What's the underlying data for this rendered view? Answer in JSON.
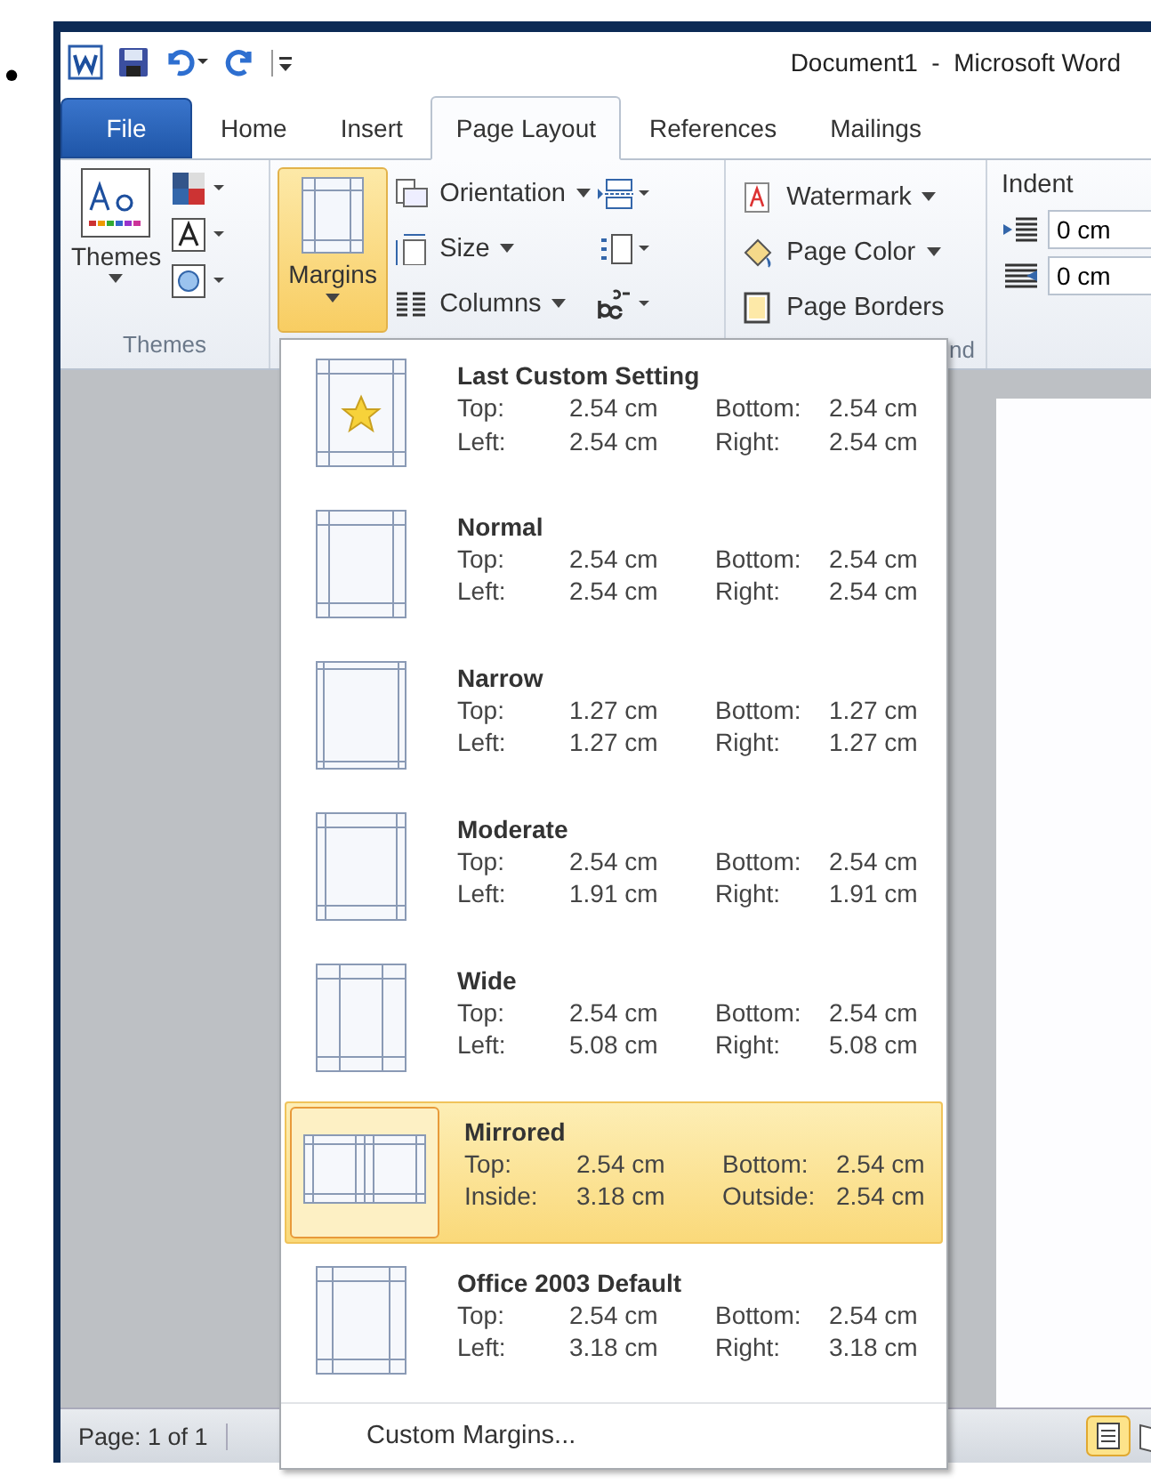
{
  "bullet": "•",
  "window": {
    "title": "Document1  -  Microsoft Word"
  },
  "tabs": [
    {
      "label": "File",
      "kind": "file",
      "selected": false
    },
    {
      "label": "Home",
      "kind": "tab",
      "selected": false
    },
    {
      "label": "Insert",
      "kind": "tab",
      "selected": false
    },
    {
      "label": "Page Layout",
      "kind": "tab",
      "selected": true
    },
    {
      "label": "References",
      "kind": "tab",
      "selected": false
    },
    {
      "label": "Mailings",
      "kind": "tab",
      "selected": false
    }
  ],
  "ribbon": {
    "themes_button": "Themes",
    "themes_group": "Themes",
    "margins_button": "Margins",
    "setup_items": [
      {
        "label": "Orientation",
        "kind": "orientation"
      },
      {
        "label": "Size",
        "kind": "size"
      },
      {
        "label": "Columns",
        "kind": "columns"
      }
    ],
    "background_items": [
      {
        "label": "Watermark",
        "kind": "watermark",
        "dropdown": true
      },
      {
        "label": "Page Color",
        "kind": "pagecolor",
        "dropdown": true
      },
      {
        "label": "Page Borders",
        "kind": "borders",
        "dropdown": false
      }
    ],
    "background_group": "nd",
    "indent_label": "Indent",
    "indent_fields": [
      {
        "value": "0 cm",
        "kind": "left"
      },
      {
        "value": "0 cm",
        "kind": "right"
      }
    ]
  },
  "margins_menu": {
    "items": [
      {
        "name": "Last Custom Setting",
        "kind": "star",
        "selected": false,
        "rows": [
          [
            "Top:",
            "2.54 cm",
            "Bottom:",
            "2.54 cm"
          ],
          [
            "Left:",
            "2.54 cm",
            "Right:",
            "2.54 cm"
          ]
        ]
      },
      {
        "name": "Normal",
        "kind": "normal",
        "selected": false,
        "rows": [
          [
            "Top:",
            "2.54 cm",
            "Bottom:",
            "2.54 cm"
          ],
          [
            "Left:",
            "2.54 cm",
            "Right:",
            "2.54 cm"
          ]
        ]
      },
      {
        "name": "Narrow",
        "kind": "narrow",
        "selected": false,
        "rows": [
          [
            "Top:",
            "1.27 cm",
            "Bottom:",
            "1.27 cm"
          ],
          [
            "Left:",
            "1.27 cm",
            "Right:",
            "1.27 cm"
          ]
        ]
      },
      {
        "name": "Moderate",
        "kind": "moderate",
        "selected": false,
        "rows": [
          [
            "Top:",
            "2.54 cm",
            "Bottom:",
            "2.54 cm"
          ],
          [
            "Left:",
            "1.91 cm",
            "Right:",
            "1.91 cm"
          ]
        ]
      },
      {
        "name": "Wide",
        "kind": "wide",
        "selected": false,
        "rows": [
          [
            "Top:",
            "2.54 cm",
            "Bottom:",
            "2.54 cm"
          ],
          [
            "Left:",
            "5.08 cm",
            "Right:",
            "5.08 cm"
          ]
        ]
      },
      {
        "name": "Mirrored",
        "kind": "mirrored",
        "selected": true,
        "rows": [
          [
            "Top:",
            "2.54 cm",
            "Bottom:",
            "2.54 cm"
          ],
          [
            "Inside:",
            "3.18 cm",
            "Outside:",
            "2.54 cm"
          ]
        ]
      },
      {
        "name": "Office 2003 Default",
        "kind": "office",
        "selected": false,
        "rows": [
          [
            "Top:",
            "2.54 cm",
            "Bottom:",
            "2.54 cm"
          ],
          [
            "Left:",
            "3.18 cm",
            "Right:",
            "3.18 cm"
          ]
        ]
      }
    ],
    "custom": "Custom Margins..."
  },
  "status_bar": {
    "page": "Page: 1 of 1"
  }
}
